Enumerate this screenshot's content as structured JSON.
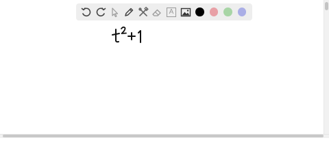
{
  "toolbar": {
    "tools": [
      {
        "name": "undo-icon"
      },
      {
        "name": "redo-icon"
      },
      {
        "name": "select-pointer-icon"
      },
      {
        "name": "pencil-icon"
      },
      {
        "name": "tools-icon"
      },
      {
        "name": "eraser-icon"
      },
      {
        "name": "text-box-icon",
        "label": "A"
      },
      {
        "name": "image-icon"
      }
    ],
    "colors": [
      {
        "name": "black",
        "hex": "#000000",
        "selected": true
      },
      {
        "name": "red",
        "hex": "#e8a0a6",
        "selected": false
      },
      {
        "name": "green",
        "hex": "#a8d5a6",
        "selected": false
      },
      {
        "name": "blue",
        "hex": "#aaaee6",
        "selected": false
      }
    ]
  },
  "canvas": {
    "handwriting": "t²+1"
  }
}
